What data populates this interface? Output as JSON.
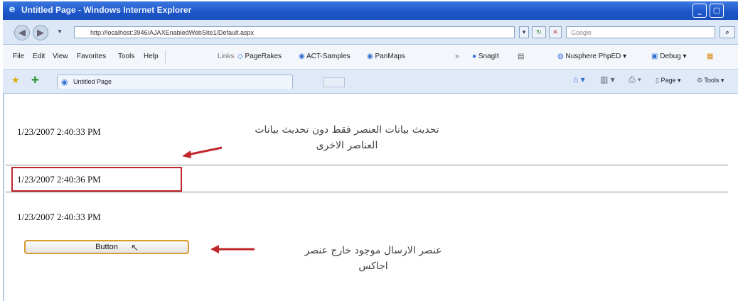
{
  "window": {
    "title": "Untitled Page - Windows Internet Explorer",
    "buttons": [
      "_",
      "▢"
    ]
  },
  "addressbar": {
    "url": "http://localhost:3946/AJAXEnabledWebSite1/Default.aspx",
    "search_placeholder": "Google"
  },
  "menubar": {
    "items": [
      "File",
      "Edit",
      "View",
      "Favorites",
      "Tools",
      "Help"
    ],
    "links_label": "Links",
    "links": [
      "PageRakes",
      "ACT-Samples",
      "PanMaps"
    ],
    "extras": [
      "SnagIt",
      "Nusphere PhpED",
      "Debug"
    ]
  },
  "tabbar": {
    "tab_label": "Untitled Page",
    "commands": [
      "Page",
      "Tools"
    ]
  },
  "content": {
    "timestamp_1": "1/23/2007 2:40:33 PM",
    "timestamp_2": "1/23/2007 2:40:36 PM",
    "timestamp_3": "1/23/2007 2:40:33 PM",
    "button_label": "Button",
    "annotation_1_line1": "تحديث بيانات العنصر فقط دون تحديث بيانات",
    "annotation_1_line2": "العناصر الاخرى",
    "annotation_2_line1": "عنصر الارسال موجود خارج عنصر",
    "annotation_2_line2": "اجاكس"
  },
  "colors": {
    "highlight": "#c0272d",
    "button_border": "#d89a2e",
    "titlebar": "#1c55c8"
  }
}
